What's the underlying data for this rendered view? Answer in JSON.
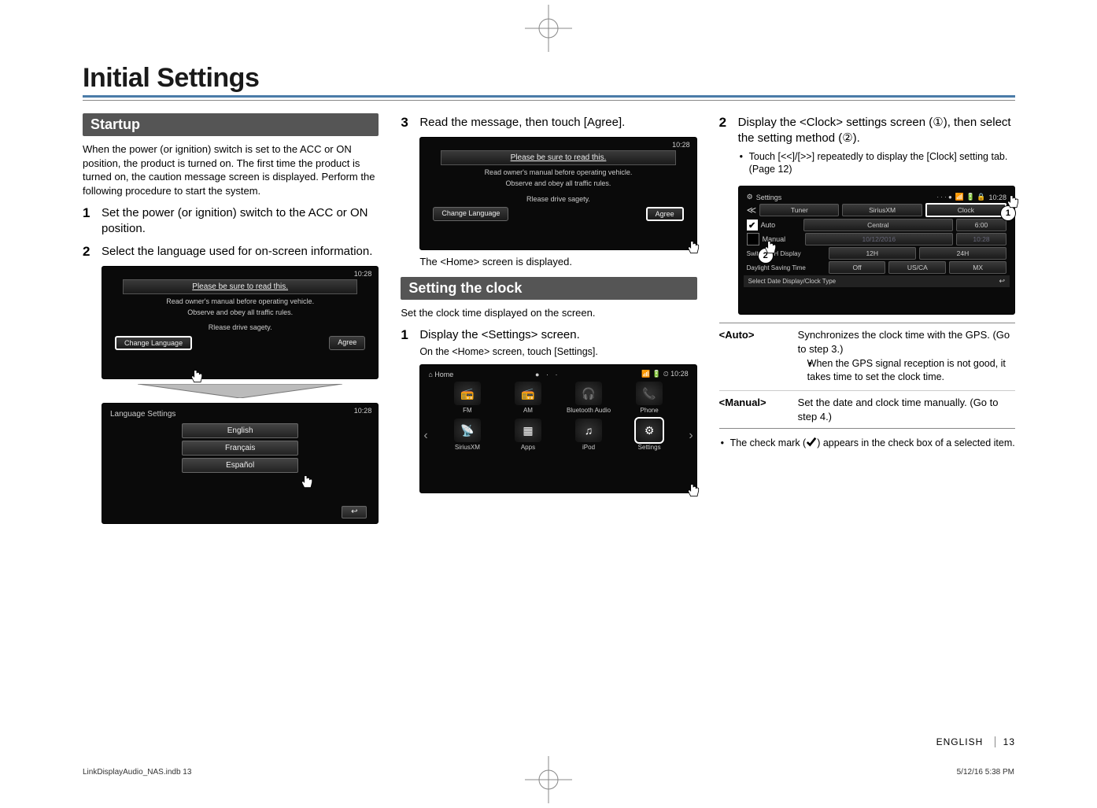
{
  "title": "Initial Settings",
  "startup": {
    "header": "Startup",
    "intro": "When the power (or ignition) switch is set to the ACC or ON position, the product is turned on. The first time the product is turned on, the caution message screen is displayed. Perform the following procedure to start the system.",
    "step1": "Set the power (or ignition) switch to the ACC or ON position.",
    "step2": "Select the language used for on-screen information."
  },
  "caution_screen": {
    "time": "10:28",
    "banner": "Please be sure to read this.",
    "line1": "Read owner's manual before operating vehicle.",
    "line2": "Observe and obey all traffic rules.",
    "line3": "Rlease drive sagety.",
    "change_lang": "Change Language",
    "agree": "Agree"
  },
  "language_screen": {
    "time": "10:28",
    "title": "Language Settings",
    "english": "English",
    "francais": "Français",
    "espanol": "Español"
  },
  "col2": {
    "step3": "Read the message, then touch [Agree].",
    "home_displayed": "The <Home> screen is displayed.",
    "clock_header": "Setting the clock",
    "clock_intro": "Set the clock time displayed on the screen.",
    "step1": "Display the <Settings> screen.",
    "step1_sub": "On the <Home> screen, touch [Settings]."
  },
  "home_screen": {
    "time": "10:28",
    "label": "Home",
    "dots": "● · ·",
    "status": "📶 🔋 ⏲",
    "tiles": {
      "fm": "FM",
      "am": "AM",
      "bt": "Bluetooth Audio",
      "phone": "Phone",
      "sxm": "SiriusXM",
      "apps": "Apps",
      "ipod": "iPod",
      "settings": "Settings"
    }
  },
  "col3": {
    "step2": "Display the <Clock> settings screen (①), then select the setting method (②).",
    "step2_bullet": "Touch [<<]/[>>] repeatedly to display the [Clock] setting tab. (Page 12)"
  },
  "clock_screen": {
    "time": "10:28",
    "settings": "Settings",
    "tabs": {
      "tuner": "Tuner",
      "sxm": "SiriusXM",
      "clock": "Clock"
    },
    "auto": "Auto",
    "central": "Central",
    "auto_time": "6:00",
    "manual": "Manual",
    "date": "10/12/2016",
    "manual_time": "10:28",
    "switch": "Switch 24H Display",
    "h12": "12H",
    "h24": "24H",
    "dst": "Daylight Saving Time",
    "off": "Off",
    "usca": "US/CA",
    "mx": "MX",
    "footer": "Select Date Display/Clock Type"
  },
  "options": {
    "auto_key": "<Auto>",
    "auto_val": "Synchronizes the clock time with the GPS. (Go to step 3.)",
    "auto_sub": "When the GPS signal reception is not good, it takes time to set the clock time.",
    "manual_key": "<Manual>",
    "manual_val": "Set the date and clock time manually. (Go to step 4.)"
  },
  "check_note_a": "The check mark (",
  "check_note_b": ") appears in the check box of a selected item.",
  "footer": {
    "lang": "ENGLISH",
    "page": "13"
  },
  "print": {
    "file": "LinkDisplayAudio_NAS.indb   13",
    "ts": "5/12/16   5:38 PM"
  },
  "icons": {
    "home": "⌂",
    "fm": "📻",
    "am": "📻",
    "bt": "🎧",
    "phone": "📞",
    "sxm": "📡",
    "apps": "▦",
    "ipod": "♫",
    "gear": "⚙"
  }
}
